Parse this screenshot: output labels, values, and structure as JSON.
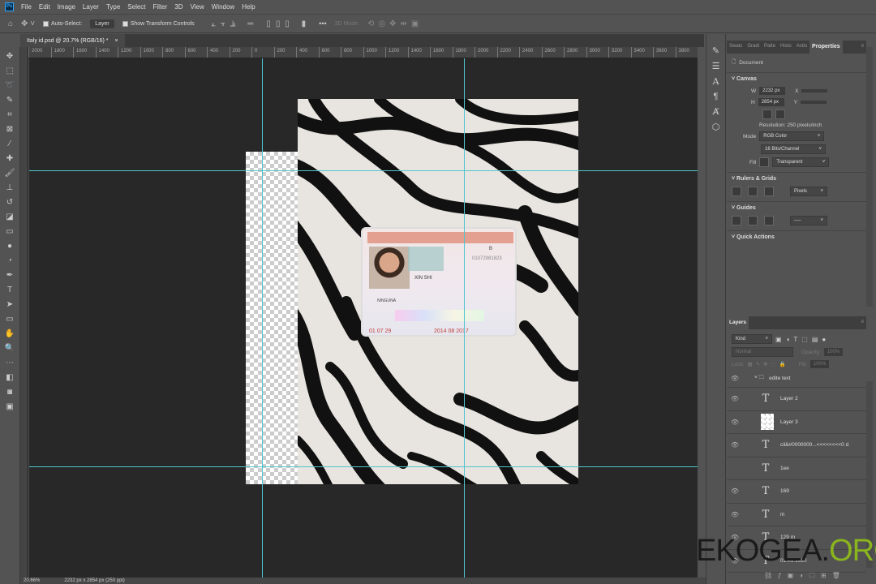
{
  "app_icon": "Ps",
  "menu": [
    "File",
    "Edit",
    "Image",
    "Layer",
    "Type",
    "Select",
    "Filter",
    "3D",
    "View",
    "Window",
    "Help"
  ],
  "options": {
    "auto_select": "Auto-Select:",
    "auto_select_target": "Layer",
    "show_transform": "Show Transform Controls",
    "mode_3d": "3D Mode:",
    "more": "•••"
  },
  "tab": {
    "title": "Italy id.psd @ 20.7% (RGB/16) *",
    "close": "×"
  },
  "ruler_ticks": [
    "2000",
    "1800",
    "1600",
    "1400",
    "1200",
    "1000",
    "800",
    "600",
    "400",
    "200",
    "0",
    "200",
    "400",
    "600",
    "800",
    "1000",
    "1200",
    "1400",
    "1600",
    "1800",
    "2000",
    "2200",
    "2400",
    "2600",
    "2800",
    "3000",
    "3200",
    "3400",
    "3600",
    "3800"
  ],
  "status": {
    "zoom": "20.66%",
    "doc": "2232 px x 2854 px (250 ppi)"
  },
  "id_card": {
    "number": "01072981823",
    "letter": "B",
    "name": "XIN SHI",
    "place": "NINGUNA",
    "date1": "01  07  29",
    "date2": "2014  08  2017"
  },
  "properties": {
    "tabs": [
      "Swatc",
      "Gradi",
      "Patte",
      "Histo",
      "Actio",
      "Properties"
    ],
    "kind": "Document",
    "canvas": {
      "title": "Canvas",
      "w_label": "W",
      "w": "2232 px",
      "h_label": "H",
      "h": "2854 px",
      "x_label": "X",
      "y_label": "Y",
      "resolution": "Resolution: 250 pixels/inch",
      "mode_label": "Mode",
      "mode": "RGB Color",
      "depth": "16 Bits/Channel",
      "fill_label": "Fill",
      "fill": "Transparent"
    },
    "rulers": {
      "title": "Rulers & Grids",
      "unit": "Pixels"
    },
    "guides": {
      "title": "Guides"
    },
    "quick_actions": {
      "title": "Quick Actions"
    }
  },
  "layers": {
    "title": "Layers",
    "filter": "Kind",
    "blend": "Normal",
    "opacity_label": "Opacity:",
    "opacity": "100%",
    "lock_label": "Lock:",
    "fill_label": "Fill:",
    "fill": "100%",
    "group": "edite text",
    "items": [
      {
        "name": "Layer 2",
        "type": "text"
      },
      {
        "name": "Layer 3",
        "type": "image"
      },
      {
        "name": "cil&#0000000...<<<<<<<<0 d",
        "type": "text"
      },
      {
        "name": "1ee",
        "type": "text"
      },
      {
        "name": "169",
        "type": "text"
      },
      {
        "name": "m",
        "type": "text"
      },
      {
        "name": "129 m",
        "type": "text"
      },
      {
        "name": "01.01.1990",
        "type": "text"
      }
    ]
  },
  "watermark": {
    "a": "EKOGEA.",
    "b": "ORG"
  }
}
